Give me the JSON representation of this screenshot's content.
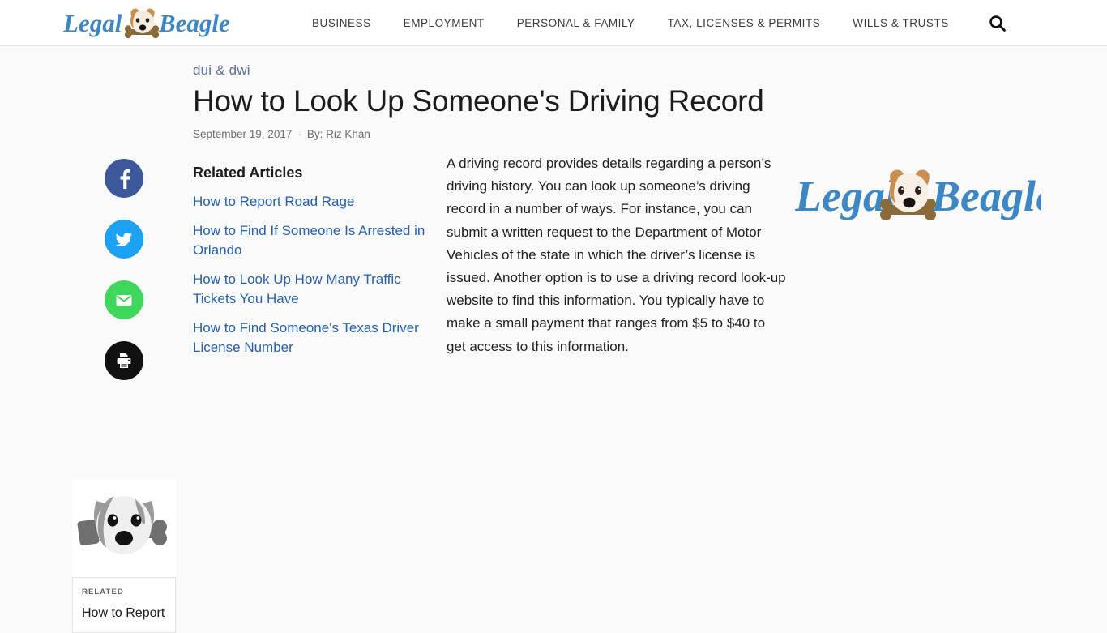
{
  "site": {
    "brand_name": "Legal Beagle",
    "brand_word_1": "Legal",
    "brand_word_2": "Beagle",
    "brand_blue": "#3d87c4",
    "accent_link": "#2560ac"
  },
  "header": {
    "logo_alt": "Legal Beagle",
    "nav": [
      {
        "label": "BUSINESS"
      },
      {
        "label": "EMPLOYMENT"
      },
      {
        "label": "PERSONAL & FAMILY"
      },
      {
        "label": "TAX, LICENSES & PERMITS"
      },
      {
        "label": "WILLS & TRUSTS"
      }
    ],
    "search_icon": "search-icon"
  },
  "article": {
    "category": "dui & dwi",
    "title": "How to Look Up Someone's Driving Record",
    "date": "September 19, 2017",
    "byline_separator": "·",
    "author": "By:  Riz Khan",
    "body_paragraph": "A driving record provides details regarding a person’s driving history. You can look up someone’s driving record in a number of ways. For instance, you can submit a written request to the Department of Motor Vehicles of the state in which the driver’s license is issued. Another option is to use a driving record look-up website to find this information. You typically have to make a small payment that ranges from $5 to $40 to get access to this information."
  },
  "share": {
    "buttons": [
      {
        "name": "facebook",
        "icon": "facebook-icon",
        "color": "#3b5998"
      },
      {
        "name": "twitter",
        "icon": "twitter-icon",
        "color": "#1da1f2"
      },
      {
        "name": "email",
        "icon": "email-icon",
        "color": "#3ed65b"
      },
      {
        "name": "print",
        "icon": "print-icon",
        "color": "#111111"
      }
    ]
  },
  "related": {
    "heading": "Related Articles",
    "items": [
      {
        "label": "How to Report Road Rage"
      },
      {
        "label": "How to Find If Someone Is Arrested in Orlando"
      },
      {
        "label": "How to Look Up How Many Traffic Tickets You Have"
      },
      {
        "label": "How to Find Someone's Texas Driver License Number"
      }
    ]
  },
  "related_card": {
    "kicker": "RELATED",
    "title": "How to Report",
    "thumb_alt": "beagle-dog-with-gavel-bone"
  }
}
